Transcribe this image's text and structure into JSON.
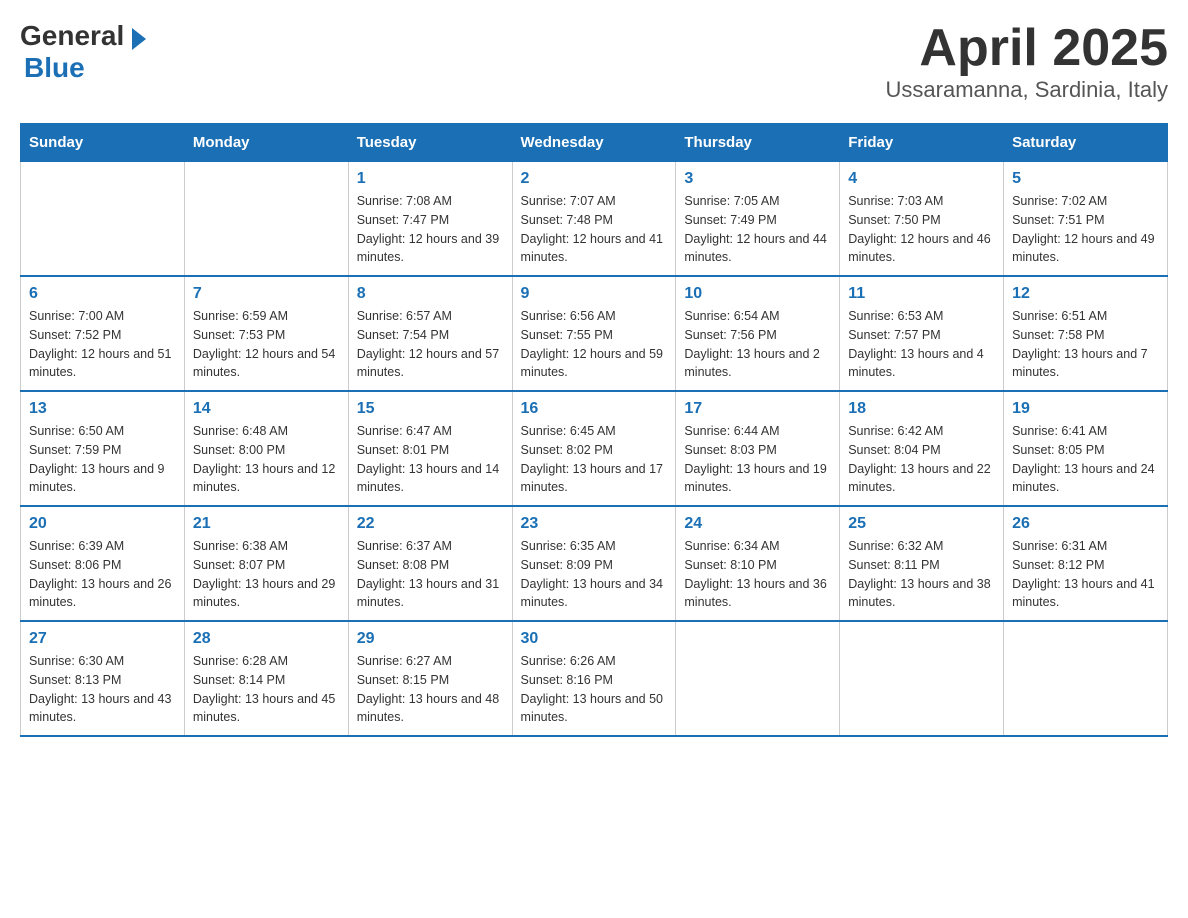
{
  "header": {
    "logo": {
      "general": "General",
      "blue": "Blue"
    },
    "title": "April 2025",
    "subtitle": "Ussaramanna, Sardinia, Italy"
  },
  "calendar": {
    "days_of_week": [
      "Sunday",
      "Monday",
      "Tuesday",
      "Wednesday",
      "Thursday",
      "Friday",
      "Saturday"
    ],
    "weeks": [
      [
        {
          "day": "",
          "sunrise": "",
          "sunset": "",
          "daylight": ""
        },
        {
          "day": "",
          "sunrise": "",
          "sunset": "",
          "daylight": ""
        },
        {
          "day": "1",
          "sunrise": "Sunrise: 7:08 AM",
          "sunset": "Sunset: 7:47 PM",
          "daylight": "Daylight: 12 hours and 39 minutes."
        },
        {
          "day": "2",
          "sunrise": "Sunrise: 7:07 AM",
          "sunset": "Sunset: 7:48 PM",
          "daylight": "Daylight: 12 hours and 41 minutes."
        },
        {
          "day": "3",
          "sunrise": "Sunrise: 7:05 AM",
          "sunset": "Sunset: 7:49 PM",
          "daylight": "Daylight: 12 hours and 44 minutes."
        },
        {
          "day": "4",
          "sunrise": "Sunrise: 7:03 AM",
          "sunset": "Sunset: 7:50 PM",
          "daylight": "Daylight: 12 hours and 46 minutes."
        },
        {
          "day": "5",
          "sunrise": "Sunrise: 7:02 AM",
          "sunset": "Sunset: 7:51 PM",
          "daylight": "Daylight: 12 hours and 49 minutes."
        }
      ],
      [
        {
          "day": "6",
          "sunrise": "Sunrise: 7:00 AM",
          "sunset": "Sunset: 7:52 PM",
          "daylight": "Daylight: 12 hours and 51 minutes."
        },
        {
          "day": "7",
          "sunrise": "Sunrise: 6:59 AM",
          "sunset": "Sunset: 7:53 PM",
          "daylight": "Daylight: 12 hours and 54 minutes."
        },
        {
          "day": "8",
          "sunrise": "Sunrise: 6:57 AM",
          "sunset": "Sunset: 7:54 PM",
          "daylight": "Daylight: 12 hours and 57 minutes."
        },
        {
          "day": "9",
          "sunrise": "Sunrise: 6:56 AM",
          "sunset": "Sunset: 7:55 PM",
          "daylight": "Daylight: 12 hours and 59 minutes."
        },
        {
          "day": "10",
          "sunrise": "Sunrise: 6:54 AM",
          "sunset": "Sunset: 7:56 PM",
          "daylight": "Daylight: 13 hours and 2 minutes."
        },
        {
          "day": "11",
          "sunrise": "Sunrise: 6:53 AM",
          "sunset": "Sunset: 7:57 PM",
          "daylight": "Daylight: 13 hours and 4 minutes."
        },
        {
          "day": "12",
          "sunrise": "Sunrise: 6:51 AM",
          "sunset": "Sunset: 7:58 PM",
          "daylight": "Daylight: 13 hours and 7 minutes."
        }
      ],
      [
        {
          "day": "13",
          "sunrise": "Sunrise: 6:50 AM",
          "sunset": "Sunset: 7:59 PM",
          "daylight": "Daylight: 13 hours and 9 minutes."
        },
        {
          "day": "14",
          "sunrise": "Sunrise: 6:48 AM",
          "sunset": "Sunset: 8:00 PM",
          "daylight": "Daylight: 13 hours and 12 minutes."
        },
        {
          "day": "15",
          "sunrise": "Sunrise: 6:47 AM",
          "sunset": "Sunset: 8:01 PM",
          "daylight": "Daylight: 13 hours and 14 minutes."
        },
        {
          "day": "16",
          "sunrise": "Sunrise: 6:45 AM",
          "sunset": "Sunset: 8:02 PM",
          "daylight": "Daylight: 13 hours and 17 minutes."
        },
        {
          "day": "17",
          "sunrise": "Sunrise: 6:44 AM",
          "sunset": "Sunset: 8:03 PM",
          "daylight": "Daylight: 13 hours and 19 minutes."
        },
        {
          "day": "18",
          "sunrise": "Sunrise: 6:42 AM",
          "sunset": "Sunset: 8:04 PM",
          "daylight": "Daylight: 13 hours and 22 minutes."
        },
        {
          "day": "19",
          "sunrise": "Sunrise: 6:41 AM",
          "sunset": "Sunset: 8:05 PM",
          "daylight": "Daylight: 13 hours and 24 minutes."
        }
      ],
      [
        {
          "day": "20",
          "sunrise": "Sunrise: 6:39 AM",
          "sunset": "Sunset: 8:06 PM",
          "daylight": "Daylight: 13 hours and 26 minutes."
        },
        {
          "day": "21",
          "sunrise": "Sunrise: 6:38 AM",
          "sunset": "Sunset: 8:07 PM",
          "daylight": "Daylight: 13 hours and 29 minutes."
        },
        {
          "day": "22",
          "sunrise": "Sunrise: 6:37 AM",
          "sunset": "Sunset: 8:08 PM",
          "daylight": "Daylight: 13 hours and 31 minutes."
        },
        {
          "day": "23",
          "sunrise": "Sunrise: 6:35 AM",
          "sunset": "Sunset: 8:09 PM",
          "daylight": "Daylight: 13 hours and 34 minutes."
        },
        {
          "day": "24",
          "sunrise": "Sunrise: 6:34 AM",
          "sunset": "Sunset: 8:10 PM",
          "daylight": "Daylight: 13 hours and 36 minutes."
        },
        {
          "day": "25",
          "sunrise": "Sunrise: 6:32 AM",
          "sunset": "Sunset: 8:11 PM",
          "daylight": "Daylight: 13 hours and 38 minutes."
        },
        {
          "day": "26",
          "sunrise": "Sunrise: 6:31 AM",
          "sunset": "Sunset: 8:12 PM",
          "daylight": "Daylight: 13 hours and 41 minutes."
        }
      ],
      [
        {
          "day": "27",
          "sunrise": "Sunrise: 6:30 AM",
          "sunset": "Sunset: 8:13 PM",
          "daylight": "Daylight: 13 hours and 43 minutes."
        },
        {
          "day": "28",
          "sunrise": "Sunrise: 6:28 AM",
          "sunset": "Sunset: 8:14 PM",
          "daylight": "Daylight: 13 hours and 45 minutes."
        },
        {
          "day": "29",
          "sunrise": "Sunrise: 6:27 AM",
          "sunset": "Sunset: 8:15 PM",
          "daylight": "Daylight: 13 hours and 48 minutes."
        },
        {
          "day": "30",
          "sunrise": "Sunrise: 6:26 AM",
          "sunset": "Sunset: 8:16 PM",
          "daylight": "Daylight: 13 hours and 50 minutes."
        },
        {
          "day": "",
          "sunrise": "",
          "sunset": "",
          "daylight": ""
        },
        {
          "day": "",
          "sunrise": "",
          "sunset": "",
          "daylight": ""
        },
        {
          "day": "",
          "sunrise": "",
          "sunset": "",
          "daylight": ""
        }
      ]
    ]
  }
}
